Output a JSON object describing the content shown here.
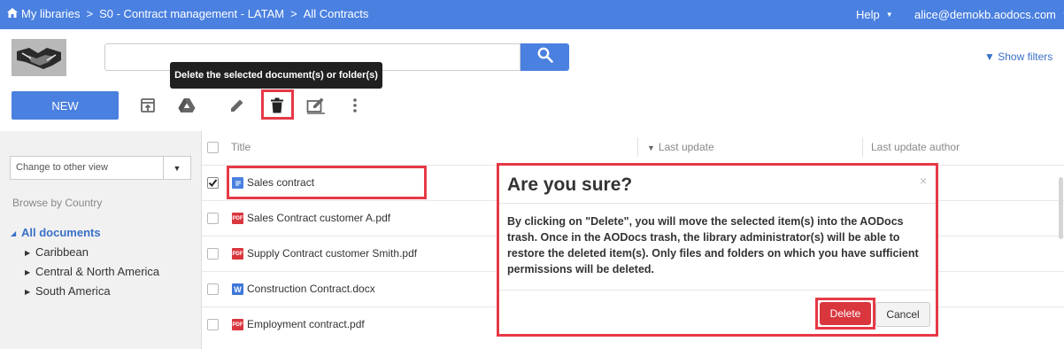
{
  "topbar": {
    "breadcrumb": [
      "My libraries",
      "S0 - Contract management - LATAM",
      "All Contracts"
    ],
    "separator": ">",
    "help_label": "Help",
    "user_email": "alice@demokb.aodocs.com",
    "bg_color": "#4a80e0"
  },
  "search": {
    "placeholder": "",
    "value": ""
  },
  "show_filters_label": "▼ Show filters",
  "tooltip_text": "Delete the selected document(s) or folder(s)",
  "toolbar": {
    "new_label": "NEW",
    "icons": [
      "upload-icon",
      "google-drive-icon",
      "edit-icon",
      "trash-icon",
      "edit-properties-icon",
      "more-vert-icon"
    ]
  },
  "sidebar": {
    "view_select_value": "Change to other view",
    "browse_title": "Browse by Country",
    "root_label": "All documents",
    "children": [
      "Caribbean",
      "Central & North America",
      "South America"
    ]
  },
  "table": {
    "columns": [
      "Title",
      "Last update",
      "Last update author"
    ],
    "sort_indicator": "▼",
    "rows": [
      {
        "name": "Sales contract",
        "type": "doc",
        "checked": true
      },
      {
        "name": "Sales Contract customer A.pdf",
        "type": "pdf",
        "checked": false
      },
      {
        "name": "Supply Contract customer Smith.pdf",
        "type": "pdf",
        "checked": false
      },
      {
        "name": "Construction Contract.docx",
        "type": "word",
        "checked": false
      },
      {
        "name": "Employment contract.pdf",
        "type": "pdf",
        "checked": false
      }
    ]
  },
  "modal": {
    "title": "Are you sure?",
    "close": "×",
    "body": "By clicking on \"Delete\", you will move the selected item(s) into the AODocs trash. Once in the AODocs trash, the library administrator(s) will be able to restore the deleted item(s). Only files and folders on which you have sufficient permissions will be deleted.",
    "delete_label": "Delete",
    "cancel_label": "Cancel"
  },
  "file_icon_text": {
    "pdf": "PDF",
    "word": "W"
  },
  "colors": {
    "accent": "#4a80e0",
    "highlight": "#e63946",
    "danger": "#d9363e",
    "link": "#3a70c8"
  }
}
